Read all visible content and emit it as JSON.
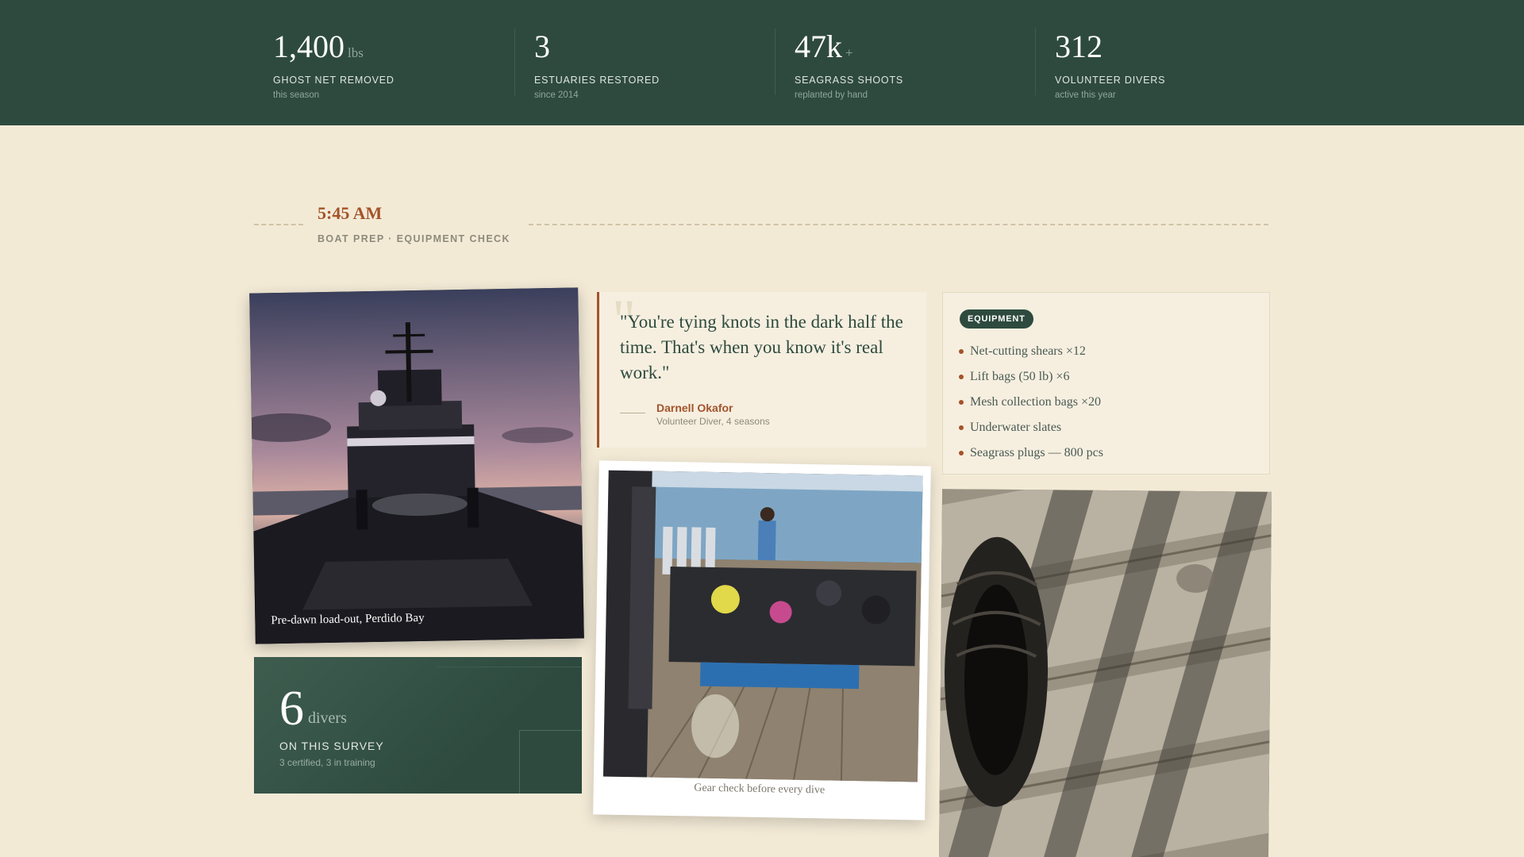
{
  "stats": [
    {
      "value": "1,400",
      "unit": "lbs",
      "label": "GHOST NET REMOVED",
      "sub": "this season"
    },
    {
      "value": "3",
      "unit": "",
      "label": "ESTUARIES RESTORED",
      "sub": "since 2014"
    },
    {
      "value": "47k",
      "unit": "+",
      "label": "SEAGRASS SHOOTS",
      "sub": "replanted by hand"
    },
    {
      "value": "312",
      "unit": "",
      "label": "VOLUNTEER DIVERS",
      "sub": "active this year"
    }
  ],
  "entry": {
    "time": "5:45 AM",
    "subtitle": "BOAT PREP · EQUIPMENT CHECK"
  },
  "photo1": {
    "caption": "Pre-dawn load-out, Perdido Bay",
    "icon": "boat-photo"
  },
  "divers": {
    "count": "6",
    "unit": "divers",
    "label": "ON THIS SURVEY",
    "sub": "3 certified, 3 in training"
  },
  "quote": {
    "mark": "\"",
    "text": "\"You're tying knots in the dark half the time. That's when you know it's real work.\"",
    "name": "Darnell Okafor",
    "role": "Volunteer Diver, 4 seasons"
  },
  "polaroid": {
    "caption": "Gear check before every dive",
    "icon": "dive-gear-photo"
  },
  "equipment": {
    "badge": "EQUIPMENT",
    "items": [
      "Net-cutting shears ×12",
      "Lift bags (50 lb) ×6",
      "Mesh collection bags ×20",
      "Underwater slates",
      "Seagrass plugs — 800 pcs"
    ]
  },
  "photo3": {
    "icon": "sandal-on-boardwalk-photo"
  },
  "colors": {
    "forest": "#2e4a3f",
    "cream": "#f3ead6",
    "rust": "#a3532a"
  }
}
